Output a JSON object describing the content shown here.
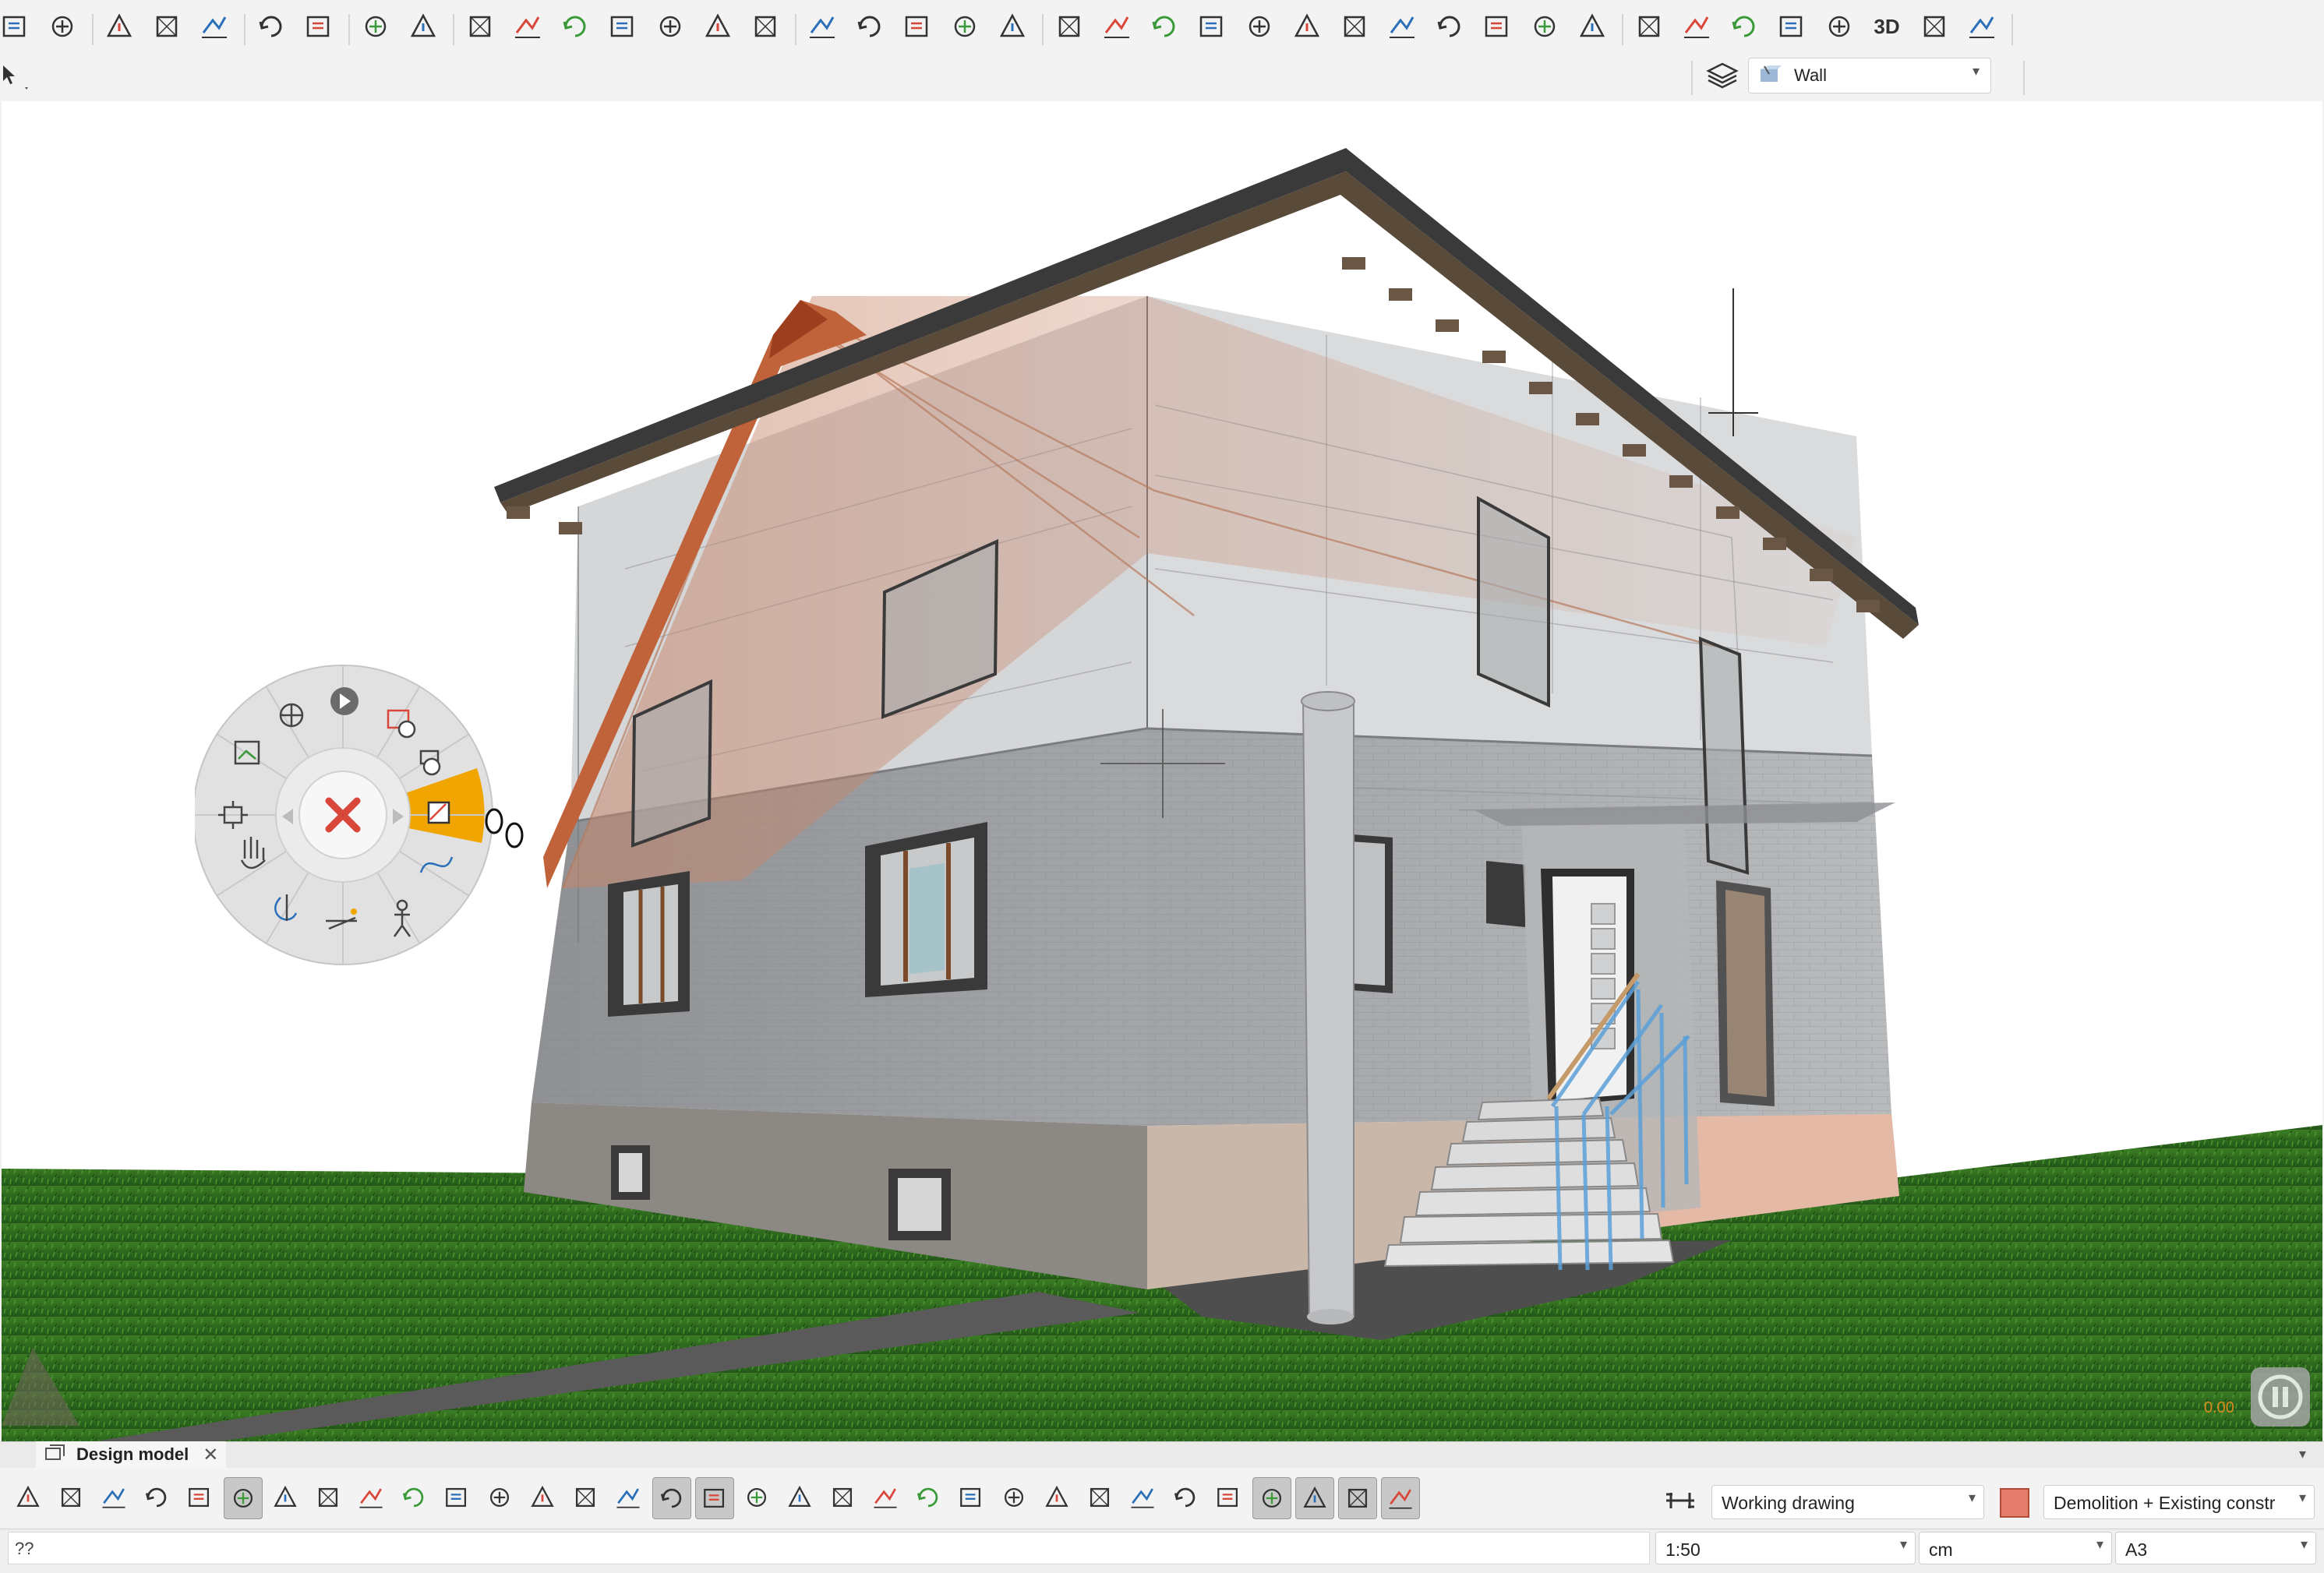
{
  "toolbar": {
    "layer_dropdown": {
      "value": "Wall"
    },
    "icons": [
      "history-icon",
      "save-icon",
      "cut-icon",
      "copy-icon",
      "paste-icon",
      "undo-icon",
      "redo-icon",
      "zoom-in-icon",
      "zoom-out-icon",
      "copy-objects-icon",
      "duplicate-icon",
      "rotate-icon",
      "mirror-icon",
      "scale-icon",
      "distort-icon",
      "align-icon",
      "split-icon",
      "divide-icon",
      "offset-icon",
      "eraser-icon",
      "modify-icon",
      "box-select-1-icon",
      "box-select-2-icon",
      "box-select-3-icon",
      "box-select-4-icon",
      "box-select-5-icon",
      "prism-icon",
      "transform-1-icon",
      "transform-2-icon",
      "transform-3-icon",
      "transform-4-icon",
      "transform-5-icon",
      "match-icon",
      "elevation-icon",
      "paint-icon",
      "roof-icon",
      "column-icon",
      "arc-icon",
      "3d-icon",
      "light-icon",
      "camera-icon"
    ],
    "label_3d": "3D"
  },
  "viewport": {
    "coordinate_readout": "0.00",
    "sky_color": "#ffffff",
    "grass_color": "#2f6b1c"
  },
  "nav_wheel": {
    "active_color": "#f0a500",
    "center_icon": "close-icon",
    "segments": [
      "pan-icon",
      "play-animation-icon",
      "view-history-icon",
      "camera-save-icon",
      "walk-mode-icon",
      "path-icon",
      "walk-settings-icon",
      "horizon-icon",
      "orbit-icon",
      "touch-pan-icon",
      "zoom-extents-icon",
      "elevation-view-icon"
    ]
  },
  "tabs": [
    {
      "label": "Design model"
    }
  ],
  "bottom_toolbar": {
    "icons": [
      "view-1-icon",
      "zoom-region-icon",
      "zoom-icon",
      "pan-view-icon",
      "fit-icon",
      "walk-icon",
      "glasses-icon",
      "window-icon",
      "split-view-icon",
      "print-icon",
      "material-1-icon",
      "material-2-icon",
      "material-3-icon",
      "material-4-icon",
      "material-5-icon",
      "sphere-icon",
      "filter-icon",
      "axis-1-icon",
      "axis-2-icon",
      "axis-3-icon",
      "axis-4-icon",
      "axis-5-icon",
      "axis-6-icon",
      "axis-7-icon",
      "grid-1-icon",
      "grid-2-icon",
      "curve-icon",
      "snap-icon",
      "dots-icon",
      "text-icon",
      "wave-icon",
      "width-icon",
      "hatch-icon"
    ],
    "drawing_type": "Working drawing",
    "layer_filter": "Demolition + Existing constr"
  },
  "status_bar": {
    "command_input": "??",
    "scale": "1:50",
    "unit": "cm",
    "paper": "A3"
  }
}
